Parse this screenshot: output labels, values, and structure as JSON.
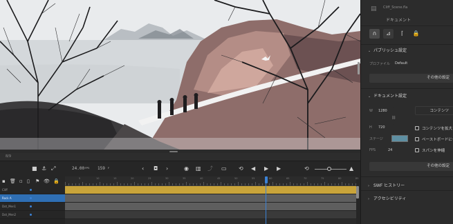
{
  "timeline": {
    "top_tab": "8/9",
    "fps": "24.00",
    "fps_unit": "FPS",
    "frame": "159",
    "frame_unit": "F",
    "ruler_marks": [
      "5",
      "10",
      "15",
      "20",
      "25",
      "30",
      "35",
      "40",
      "45",
      "50",
      "55",
      "60",
      "65",
      "70",
      "75",
      "80",
      "85"
    ],
    "layers": [
      {
        "name": "Cliff",
        "selected": false
      },
      {
        "name": "Rock A",
        "selected": true
      },
      {
        "name": "Dot_Men1",
        "selected": false
      },
      {
        "name": "Dot_Men2",
        "selected": false
      }
    ]
  },
  "panel": {
    "doc_file": "Cliff_Scene.fla",
    "doc_label": "ドキュメント",
    "publish_section": "パブリッシュ設定",
    "profile_label": "プロファイル",
    "profile_value": "Default",
    "publish_more": "その他の設定",
    "document_section": "ドキュメント設定",
    "w_label": "W",
    "w_value": "1280",
    "h_label": "H",
    "h_value": "720",
    "content_btn": "コンテンツ",
    "stage_label": "ステージ",
    "fps_label": "FPS",
    "fps_value": "24",
    "chk_scale_content": "コンテンツを拡大・縮小",
    "chk_pasteboard": "ペーストボードにクリップ",
    "chk_span": "スパンを伸縮",
    "document_more": "その他の設定",
    "swf_history": "SWF ヒストリー",
    "accessibility": "アクセシビリティ"
  },
  "colors": {
    "stage_color": "#5e8fa2",
    "keyframe_track": "#c9a43a",
    "selection": "#2f6fb4",
    "playhead": "#3b82d6"
  }
}
